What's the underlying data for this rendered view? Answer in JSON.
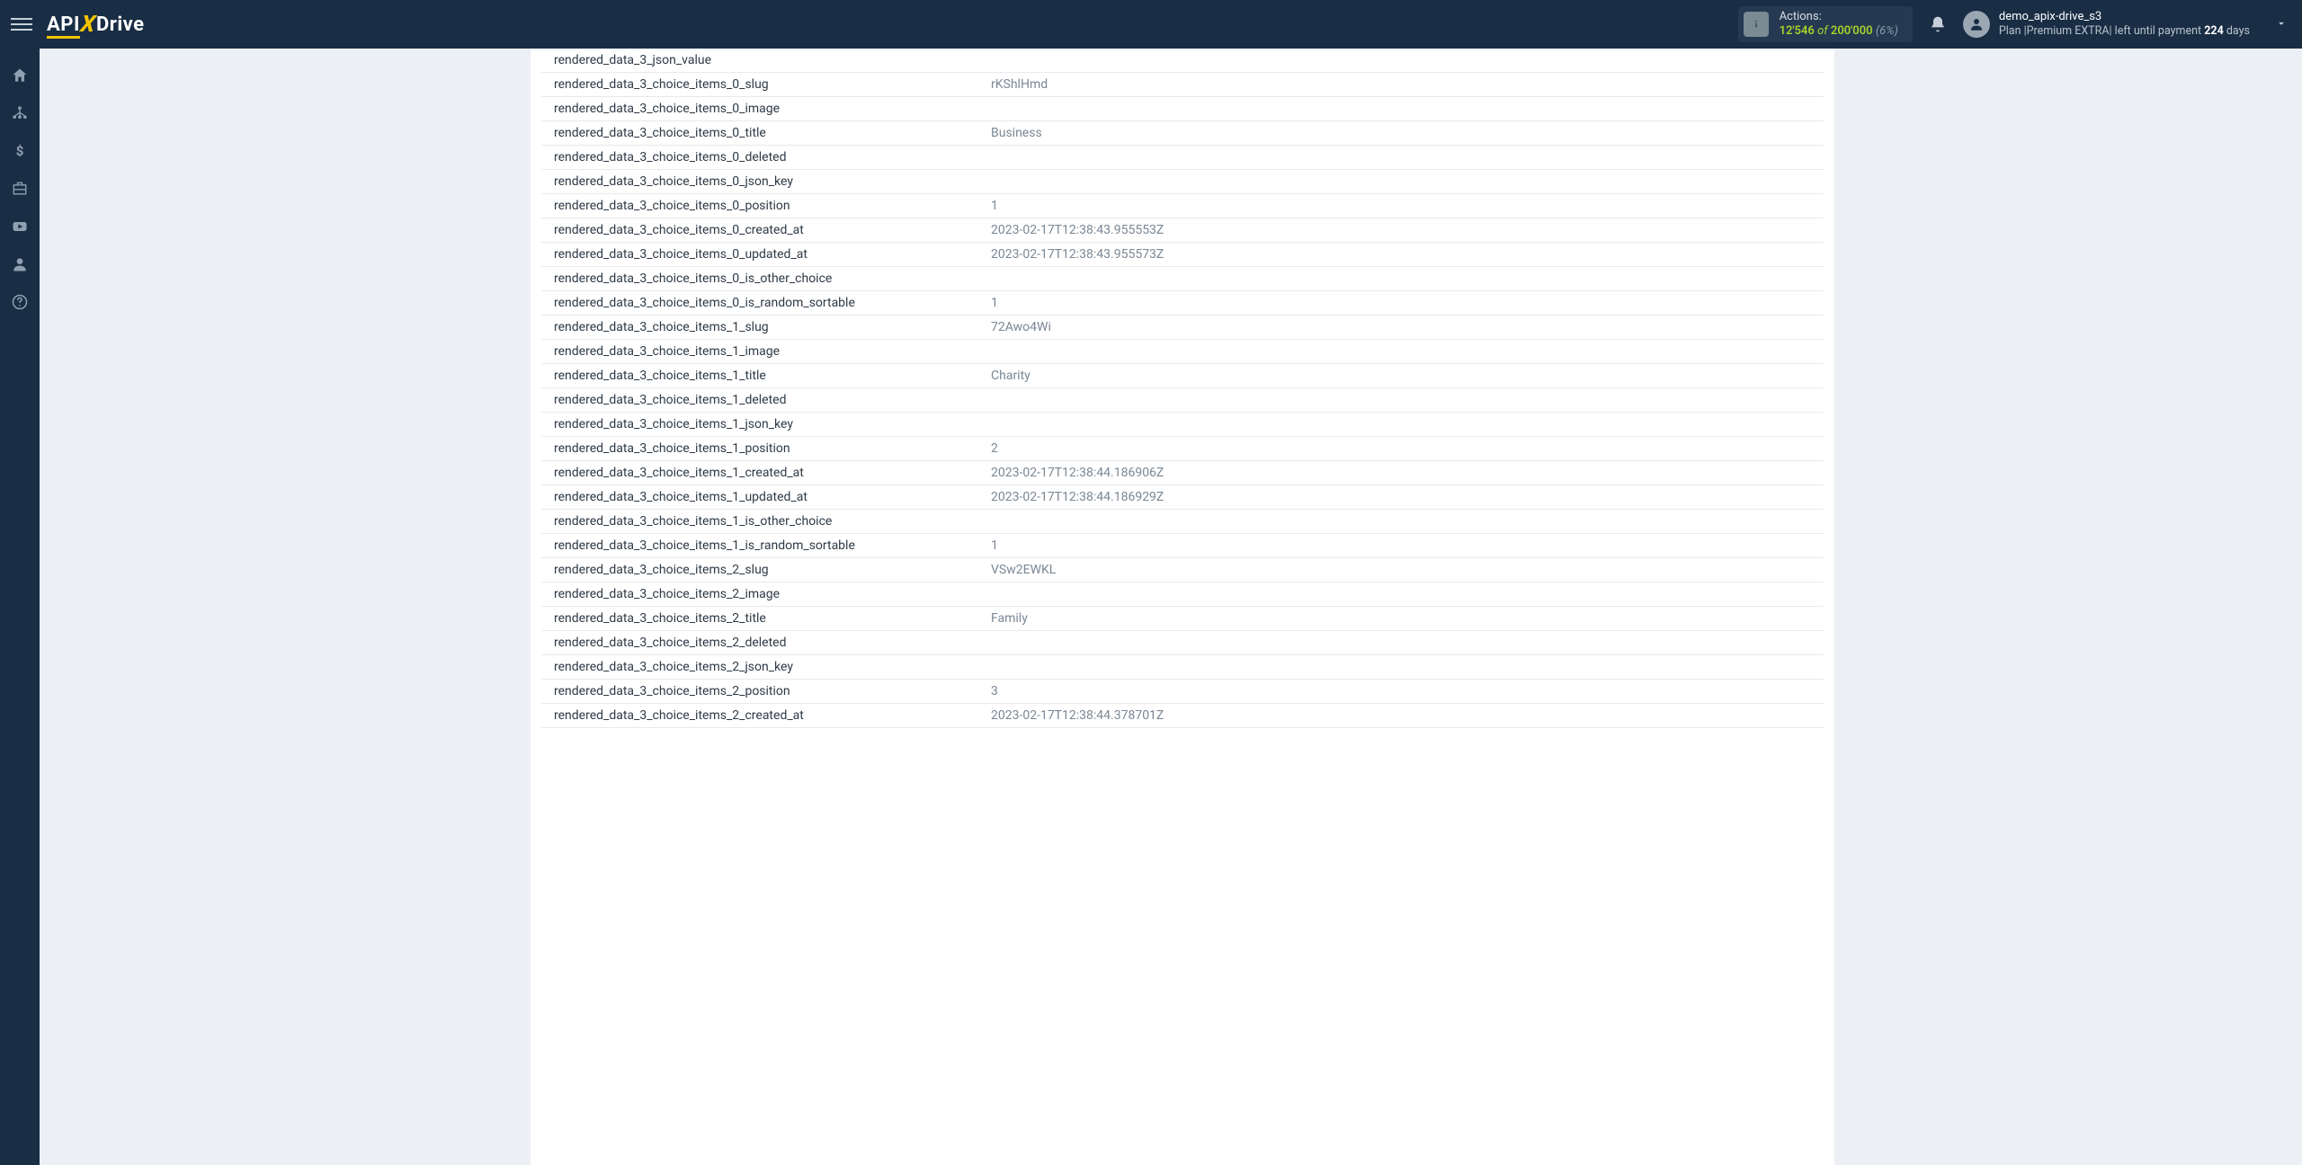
{
  "header": {
    "actions_label": "Actions:",
    "actions_used": "12'546",
    "actions_of": "of",
    "actions_total": "200'000",
    "actions_pct": "(6%)",
    "user_name": "demo_apix-drive_s3",
    "plan_prefix": "Plan  |",
    "plan_name": "Premium EXTRA",
    "plan_mid": "|  left until payment ",
    "plan_days_num": "224",
    "plan_days_suffix": " days"
  },
  "logo": {
    "part1": "API",
    "part2": "X",
    "part3": "Drive"
  },
  "rows": [
    {
      "key": "rendered_data_3_json_value",
      "val": ""
    },
    {
      "key": "rendered_data_3_choice_items_0_slug",
      "val": "rKShlHmd"
    },
    {
      "key": "rendered_data_3_choice_items_0_image",
      "val": ""
    },
    {
      "key": "rendered_data_3_choice_items_0_title",
      "val": "Business"
    },
    {
      "key": "rendered_data_3_choice_items_0_deleted",
      "val": ""
    },
    {
      "key": "rendered_data_3_choice_items_0_json_key",
      "val": ""
    },
    {
      "key": "rendered_data_3_choice_items_0_position",
      "val": "1"
    },
    {
      "key": "rendered_data_3_choice_items_0_created_at",
      "val": "2023-02-17T12:38:43.955553Z"
    },
    {
      "key": "rendered_data_3_choice_items_0_updated_at",
      "val": "2023-02-17T12:38:43.955573Z"
    },
    {
      "key": "rendered_data_3_choice_items_0_is_other_choice",
      "val": ""
    },
    {
      "key": "rendered_data_3_choice_items_0_is_random_sortable",
      "val": "1"
    },
    {
      "key": "rendered_data_3_choice_items_1_slug",
      "val": "72Awo4Wi"
    },
    {
      "key": "rendered_data_3_choice_items_1_image",
      "val": ""
    },
    {
      "key": "rendered_data_3_choice_items_1_title",
      "val": "Charity"
    },
    {
      "key": "rendered_data_3_choice_items_1_deleted",
      "val": ""
    },
    {
      "key": "rendered_data_3_choice_items_1_json_key",
      "val": ""
    },
    {
      "key": "rendered_data_3_choice_items_1_position",
      "val": "2"
    },
    {
      "key": "rendered_data_3_choice_items_1_created_at",
      "val": "2023-02-17T12:38:44.186906Z"
    },
    {
      "key": "rendered_data_3_choice_items_1_updated_at",
      "val": "2023-02-17T12:38:44.186929Z"
    },
    {
      "key": "rendered_data_3_choice_items_1_is_other_choice",
      "val": ""
    },
    {
      "key": "rendered_data_3_choice_items_1_is_random_sortable",
      "val": "1"
    },
    {
      "key": "rendered_data_3_choice_items_2_slug",
      "val": "VSw2EWKL"
    },
    {
      "key": "rendered_data_3_choice_items_2_image",
      "val": ""
    },
    {
      "key": "rendered_data_3_choice_items_2_title",
      "val": "Family"
    },
    {
      "key": "rendered_data_3_choice_items_2_deleted",
      "val": ""
    },
    {
      "key": "rendered_data_3_choice_items_2_json_key",
      "val": ""
    },
    {
      "key": "rendered_data_3_choice_items_2_position",
      "val": "3"
    },
    {
      "key": "rendered_data_3_choice_items_2_created_at",
      "val": "2023-02-17T12:38:44.378701Z"
    }
  ]
}
